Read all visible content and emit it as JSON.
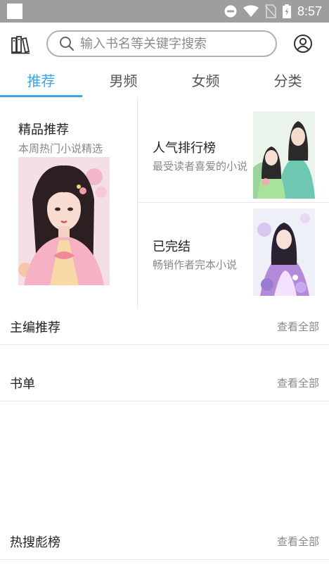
{
  "status_bar": {
    "time": "8:57"
  },
  "search": {
    "placeholder": "输入书名等关键字搜索"
  },
  "tabs": [
    {
      "label": "推荐",
      "active": true
    },
    {
      "label": "男频",
      "active": false
    },
    {
      "label": "女频",
      "active": false
    },
    {
      "label": "分类",
      "active": false
    }
  ],
  "featured": {
    "main": {
      "title": "精品推荐",
      "subtitle": "本周热门小说精选"
    },
    "popular": {
      "title": "人气排行榜",
      "subtitle": "最受读者喜爱的小说"
    },
    "completed": {
      "title": "已完结",
      "subtitle": "畅销作者完本小说"
    }
  },
  "sections": [
    {
      "title": "主编推荐",
      "more": "查看全部"
    },
    {
      "title": "书单",
      "more": "查看全部"
    },
    {
      "title": "热搜彪榜",
      "more": "查看全部"
    }
  ],
  "colors": {
    "accent": "#3aa6e8",
    "status_bar": "#9e9e9e"
  },
  "icons": [
    "bookshelf-icon",
    "search-icon",
    "profile-icon",
    "dnd-icon",
    "wifi-icon",
    "no-sim-icon",
    "battery-icon"
  ]
}
